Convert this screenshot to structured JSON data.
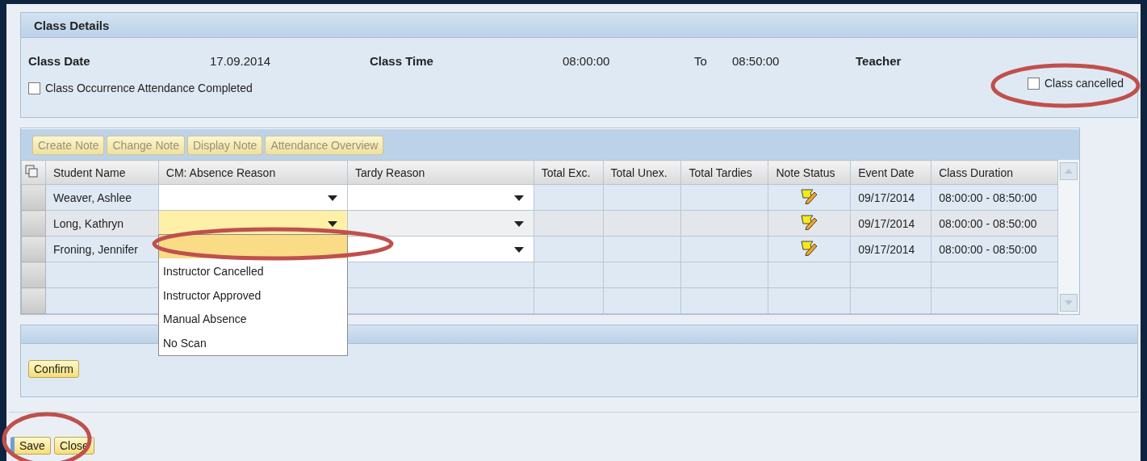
{
  "class_details": {
    "title": "Class Details",
    "class_date_label": "Class Date",
    "class_date": "17.09.2014",
    "class_time_label": "Class Time",
    "time_from": "08:00:00",
    "to_label": "To",
    "time_to": "08:50:00",
    "teacher_label": "Teacher",
    "attendance_completed": {
      "label": "Class Occurrence Attendance Completed",
      "checked": false
    },
    "class_cancelled": {
      "label": "Class cancelled",
      "checked": false
    }
  },
  "toolbar": [
    {
      "label": "Create Note",
      "disabled": true
    },
    {
      "label": "Change Note",
      "disabled": true
    },
    {
      "label": "Display Note",
      "disabled": true
    },
    {
      "label": "Attendance Overview",
      "disabled": true
    }
  ],
  "table": {
    "columns": [
      "Student Name",
      "CM: Absence Reason",
      "Tardy Reason",
      "Total Exc.",
      "Total Unex.",
      "Total Tardies",
      "Note Status",
      "Event Date",
      "Class Duration"
    ],
    "rows": [
      {
        "student": "Weaver, Ashlee",
        "selected": false,
        "event_date": "09/17/2014",
        "class_duration": "08:00:00 - 08:50:00"
      },
      {
        "student": "Long, Kathryn",
        "selected": true,
        "event_date": "09/17/2014",
        "class_duration": "08:00:00 - 08:50:00"
      },
      {
        "student": "Froning, Jennifer",
        "selected": false,
        "event_date": "09/17/2014",
        "class_duration": "08:00:00 - 08:50:00"
      }
    ]
  },
  "absence_dropdown": {
    "blank_option_highlighted": true,
    "options": [
      {
        "label": "Instructor Cancelled",
        "selected": false
      },
      {
        "label": "Instructor Approved",
        "selected": false
      },
      {
        "label": "Manual Absence",
        "selected": false
      },
      {
        "label": "No Scan",
        "selected": false
      }
    ]
  },
  "confirm_button": "Confirm",
  "footer_buttons": [
    {
      "label": "Save",
      "focused": true
    },
    {
      "label": "Close",
      "focused": false
    }
  ]
}
